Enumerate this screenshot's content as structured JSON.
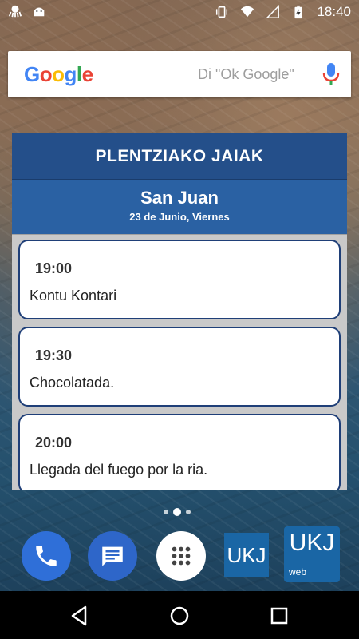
{
  "status_bar": {
    "left_icons": [
      "octopus-notification-icon",
      "android-debug-icon"
    ],
    "right_icons": [
      "vibrate-icon",
      "wifi-icon",
      "signal-icon",
      "battery-charging-icon"
    ],
    "time": "18:40"
  },
  "search": {
    "logo": "Google",
    "hint": "Di \"Ok Google\"",
    "mic_icon": "mic-icon"
  },
  "widget": {
    "title": "PLENTZIAKO JAIAK",
    "saint": "San Juan",
    "date": "23 de Junio, Viernes",
    "events": [
      {
        "time": "19:00",
        "title": "Kontu Kontari"
      },
      {
        "time": "19:30",
        "title": "Chocolatada."
      },
      {
        "time": "20:00",
        "title": "Llegada del fuego por la ria."
      }
    ]
  },
  "dock": {
    "apps": [
      {
        "name": "Phone",
        "icon": "phone-icon"
      },
      {
        "name": "Messages",
        "icon": "messages-icon"
      },
      {
        "name": "App drawer",
        "icon": "app-drawer-icon"
      },
      {
        "name": "UKJ",
        "label": "UKJ"
      },
      {
        "name": "UKJ web",
        "label": "UKJ",
        "sublabel": "web"
      }
    ],
    "page_indicator": {
      "pages": 3,
      "current": 2
    }
  },
  "colors": {
    "widget_header": "#244f8a",
    "widget_sub": "#2a61a3",
    "event_border": "#1f3f78",
    "ukj_blue": "#1a66a5"
  }
}
